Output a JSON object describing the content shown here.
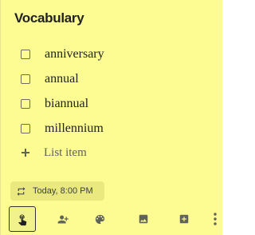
{
  "note": {
    "title": "Vocabulary",
    "items": [
      {
        "label": "anniversary",
        "checked": false
      },
      {
        "label": "annual",
        "checked": false
      },
      {
        "label": "biannual",
        "checked": false
      },
      {
        "label": "millennium",
        "checked": false
      }
    ],
    "add_item_placeholder": "List item",
    "reminder": "Today, 8:00 PM",
    "background_color": "#fcfc93"
  },
  "toolbar": {
    "icons": [
      "gesture-icon",
      "add-collaborator-icon",
      "palette-icon",
      "image-icon",
      "archive-icon",
      "more-vert-icon"
    ]
  }
}
